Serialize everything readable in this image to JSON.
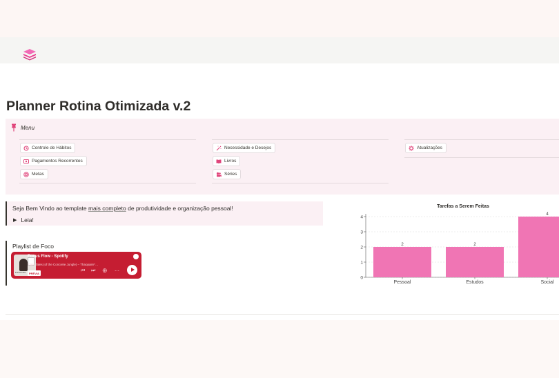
{
  "page": {
    "title": "Planner Rotina Otimizada v.2"
  },
  "menu": {
    "title": "Menu",
    "columns": [
      {
        "items": [
          {
            "label": "Controle de Hábitos",
            "icon": "habit-icon"
          },
          {
            "label": "Pagamentos Recorrentes",
            "icon": "money-icon"
          },
          {
            "label": "Metas",
            "icon": "target-icon"
          }
        ]
      },
      {
        "items": [
          {
            "label": "Necessidade e Desejos",
            "icon": "magic-wand-icon"
          },
          {
            "label": "Livros",
            "icon": "book-icon"
          },
          {
            "label": "Séries",
            "icon": "film-icon"
          }
        ]
      },
      {
        "items": [
          {
            "label": "Atualizações",
            "icon": "gear-icon"
          }
        ]
      }
    ]
  },
  "welcome": {
    "text_before": "Seja Bem Vindo ao template ",
    "text_link": "mais completo",
    "text_after": " de produtividade e organização pessoal!",
    "toggle_label": "Leia!"
  },
  "playlist": {
    "title": "Playlist de Foco",
    "embed": {
      "name": "Focus Flow - Spotify",
      "track": "Tiger Tales (of the Concrete Jungle) – Thaopaim*…",
      "badge": "PRÉVIA",
      "thumb_caption": "Focus Flow",
      "brand_color": "#c51d32"
    }
  },
  "chart_data": {
    "type": "bar",
    "title": "Tarefas a Serem Feitas",
    "categories": [
      "Pessoal",
      "Estudos",
      "Social"
    ],
    "values": [
      2,
      2,
      4
    ],
    "ylim": [
      0,
      4
    ],
    "yticks": [
      0,
      1,
      2,
      3,
      4
    ],
    "grid": true,
    "bar_color": "#f075b4",
    "data_labels": true
  }
}
